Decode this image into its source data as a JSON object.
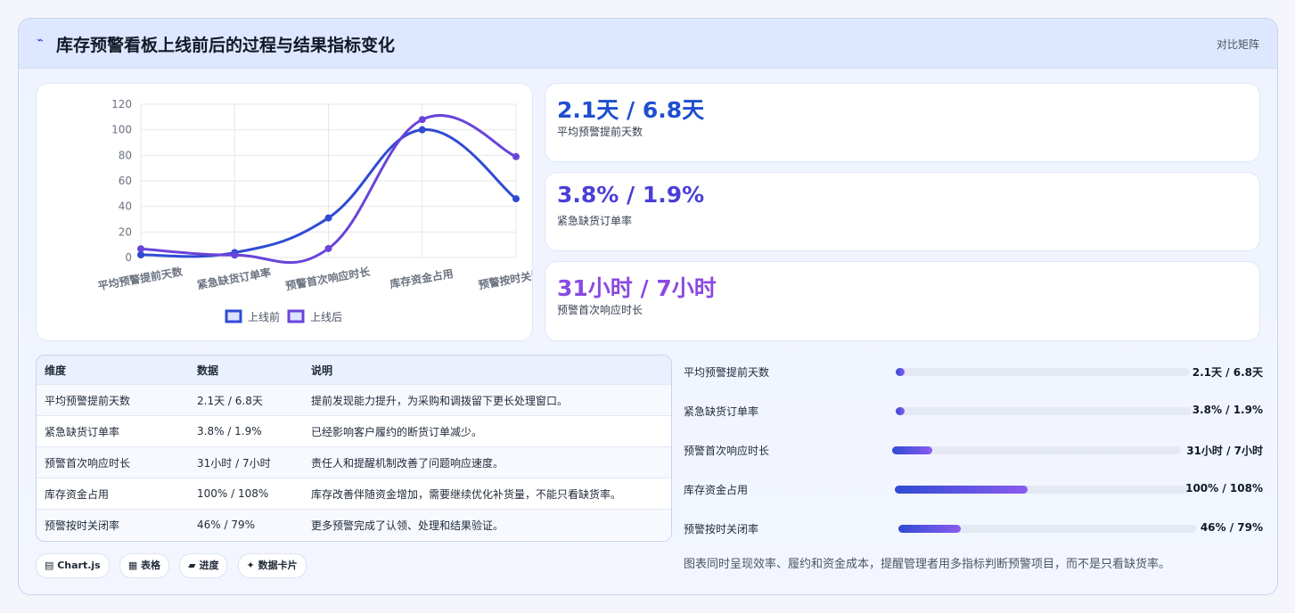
{
  "header": {
    "title": "库存预警看板上线前后的过程与结果指标变化",
    "link": "对比矩阵"
  },
  "colors": {
    "before": "#2f4bd3",
    "after": "#6a44d8",
    "stat1": "#1f4fcf",
    "stat2": "#4a3fd6",
    "stat3": "#8a4ae0"
  },
  "chart_data": {
    "type": "line",
    "categories": [
      "平均预警提前天数",
      "紧急缺货订单率",
      "预警首次响应时长",
      "库存资金占用",
      "预警按时关闭率"
    ],
    "series": [
      {
        "name": "上线前",
        "values": [
          2.1,
          3.8,
          31,
          100,
          46
        ]
      },
      {
        "name": "上线后",
        "values": [
          6.8,
          1.9,
          7,
          108,
          79
        ]
      }
    ],
    "ylim": [
      0,
      120
    ],
    "yticks": [
      "0",
      "20",
      "40",
      "60",
      "80",
      "100",
      "120"
    ],
    "grid": true,
    "legend": "bottom"
  },
  "stats": [
    {
      "value": "2.1天 / 6.8天",
      "label": "平均预警提前天数"
    },
    {
      "value": "3.8% / 1.9%",
      "label": "紧急缺货订单率"
    },
    {
      "value": "31小时 / 7小时",
      "label": "预警首次响应时长"
    }
  ],
  "table": {
    "headers": [
      "维度",
      "数据",
      "说明"
    ],
    "rows": [
      [
        "平均预警提前天数",
        "2.1天 / 6.8天",
        "提前发现能力提升，为采购和调拨留下更长处理窗口。"
      ],
      [
        "紧急缺货订单率",
        "3.8% / 1.9%",
        "已经影响客户履约的断货订单减少。"
      ],
      [
        "预警首次响应时长",
        "31小时 / 7小时",
        "责任人和提醒机制改善了问题响应速度。"
      ],
      [
        "库存资金占用",
        "100% / 108%",
        "库存改善伴随资金增加，需要继续优化补货量，不能只看缺货率。"
      ],
      [
        "预警按时关闭率",
        "46% / 79%",
        "更多预警完成了认领、处理和结果验证。"
      ]
    ]
  },
  "chips": [
    "▤ Chart.js",
    "▦ 表格",
    "▰ 进度",
    "✦ 数据卡片"
  ],
  "progress": [
    {
      "label": "平均预警提前天数",
      "value": "2.1天 / 6.8天",
      "level": 0.03
    },
    {
      "label": "紧急缺货订单率",
      "value": "3.8% / 1.9%",
      "level": 0.03
    },
    {
      "label": "预警首次响应时长",
      "value": "31小时 / 7小时",
      "level": 0.14
    },
    {
      "label": "库存资金占用",
      "value": "100% / 108%",
      "level": 0.45
    },
    {
      "label": "预警按时关闭率",
      "value": "46% / 79%",
      "level": 0.21
    }
  ],
  "note": "图表同时呈现效率、履约和资金成本，提醒管理者用多指标判断预警项目，而不是只看缺货率。"
}
